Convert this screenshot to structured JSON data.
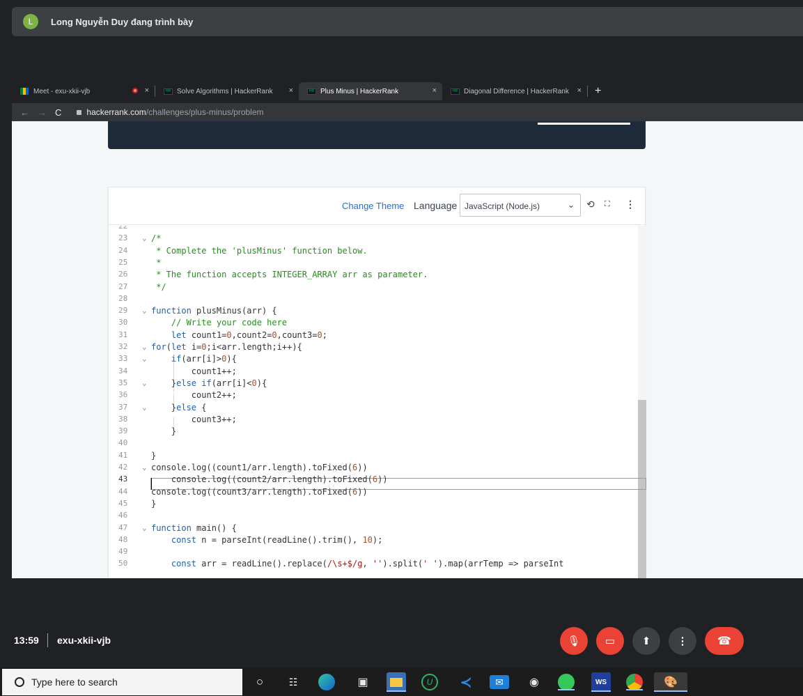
{
  "meet": {
    "avatar_letter": "L",
    "presenter_text": "Long Nguyễn Duy đang trình bày",
    "time": "13:59",
    "room_code": "exu-xkii-vjb"
  },
  "browser": {
    "tabs": [
      {
        "label": "Meet - exu-xkii-vjb",
        "active": false
      },
      {
        "label": "Solve Algorithms | HackerRank",
        "active": false
      },
      {
        "label": "Plus Minus | HackerRank",
        "active": true
      },
      {
        "label": "Diagonal Difference | HackerRank",
        "active": false
      }
    ],
    "new_tab": "+",
    "close_glyph": "×",
    "url_host": "hackerrank.com",
    "url_path": "/challenges/plus-minus/problem"
  },
  "editor": {
    "change_theme": "Change Theme",
    "language_label": "Language",
    "language_value": "JavaScript (Node.js)",
    "lines": [
      {
        "n": "22",
        "fold": false,
        "html": ""
      },
      {
        "n": "23",
        "fold": true,
        "html": "<span class=\"cm\">/*</span>"
      },
      {
        "n": "24",
        "fold": false,
        "html": "<span class=\"cm\"> * Complete the 'plusMinus' function below.</span>"
      },
      {
        "n": "25",
        "fold": false,
        "html": "<span class=\"cm\"> *</span>"
      },
      {
        "n": "26",
        "fold": false,
        "html": "<span class=\"cm\"> * The function accepts INTEGER_ARRAY arr as parameter.</span>"
      },
      {
        "n": "27",
        "fold": false,
        "html": "<span class=\"cm\"> */</span>"
      },
      {
        "n": "28",
        "fold": false,
        "html": ""
      },
      {
        "n": "29",
        "fold": true,
        "html": "<span class=\"kw\">function</span> plusMinus(arr) {"
      },
      {
        "n": "30",
        "fold": false,
        "html": "    <span class=\"cm\">// Write your code here</span>"
      },
      {
        "n": "31",
        "fold": false,
        "html": "    <span class=\"kw\">let</span> count1=<span class=\"num\">0</span>,count2=<span class=\"num\">0</span>,count3=<span class=\"num\">0</span>;"
      },
      {
        "n": "32",
        "fold": true,
        "html": "<span class=\"kw\">for</span>(<span class=\"kw\">let</span> i=<span class=\"num\">0</span>;i&lt;arr.length;i++){"
      },
      {
        "n": "33",
        "fold": true,
        "html": "    <span class=\"kw\">if</span>(arr[i]&gt;<span class=\"num\">0</span>){"
      },
      {
        "n": "34",
        "fold": false,
        "html": "        count1++;"
      },
      {
        "n": "35",
        "fold": true,
        "html": "    }<span class=\"kw\">else if</span>(arr[i]&lt;<span class=\"num\">0</span>){"
      },
      {
        "n": "36",
        "fold": false,
        "html": "        count2++;"
      },
      {
        "n": "37",
        "fold": true,
        "html": "    }<span class=\"kw\">else</span> {"
      },
      {
        "n": "38",
        "fold": false,
        "html": "        count3++;"
      },
      {
        "n": "39",
        "fold": false,
        "html": "    }"
      },
      {
        "n": "40",
        "fold": false,
        "html": ""
      },
      {
        "n": "41",
        "fold": false,
        "html": "}"
      },
      {
        "n": "42",
        "fold": true,
        "html": "console.log((count1/arr.length).toFixed(<span class=\"num\">6</span>))"
      },
      {
        "n": "43",
        "fold": false,
        "html": "    console.log((count2/arr.length).toFixed(<span class=\"num\">6</span>))"
      },
      {
        "n": "44",
        "fold": false,
        "html": "console.log((count3/arr.length).toFixed(<span class=\"num\">6</span>))"
      },
      {
        "n": "45",
        "fold": false,
        "html": "}"
      },
      {
        "n": "46",
        "fold": false,
        "html": ""
      },
      {
        "n": "47",
        "fold": true,
        "html": "<span class=\"kw\">function</span> main() {"
      },
      {
        "n": "48",
        "fold": false,
        "html": "    <span class=\"kw\">const</span> n = parseInt(readLine().trim(), <span class=\"num\">10</span>);"
      },
      {
        "n": "49",
        "fold": false,
        "html": ""
      },
      {
        "n": "50",
        "fold": false,
        "html": "    <span class=\"kw\">const</span> arr = readLine().replace(<span class=\"str\">/\\s+$/g</span>, <span class=\"str\">''</span>).split(<span class=\"str\">' '</span>).map(arrTemp =&gt; parseInt"
      }
    ]
  },
  "taskbar": {
    "search_placeholder": "Type here to search"
  },
  "colors": {
    "meet_red": "#ea4335",
    "hackerrank_link": "#1f6fd6"
  }
}
